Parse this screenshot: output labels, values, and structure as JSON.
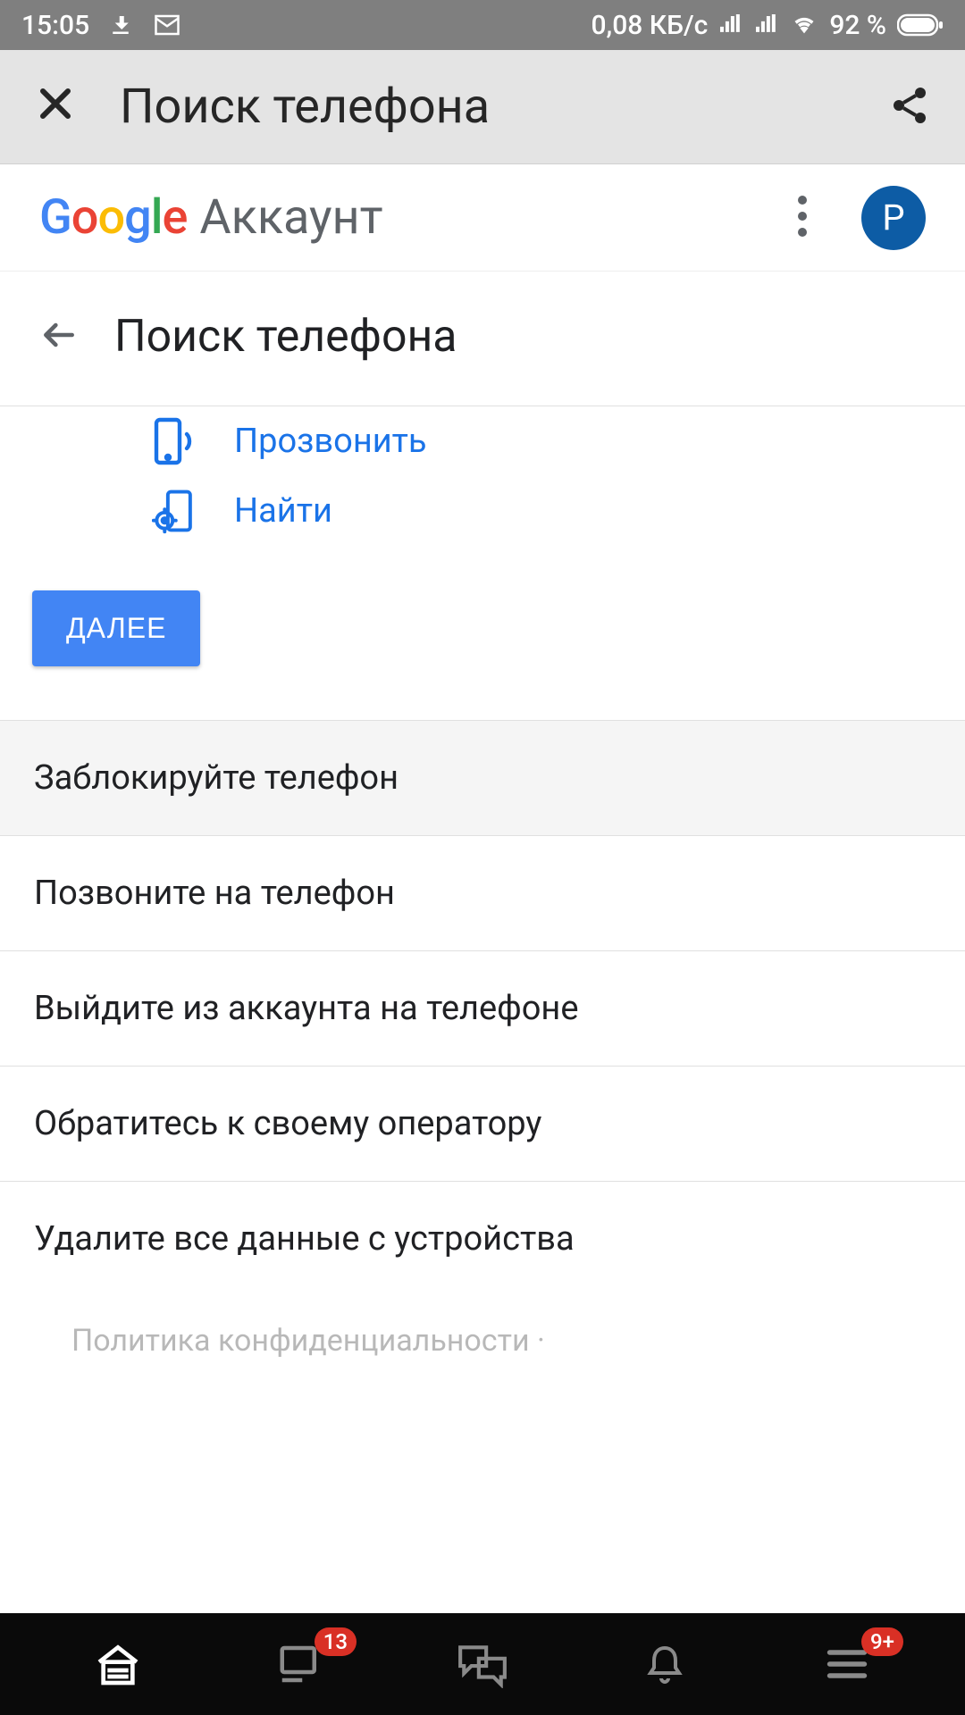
{
  "status": {
    "time": "15:05",
    "data_rate": "0,08 КБ/с",
    "battery": "92 %"
  },
  "app_header": {
    "title": "Поиск телефона"
  },
  "google_bar": {
    "account_label": "Аккаунт",
    "avatar_letter": "P"
  },
  "page": {
    "title": "Поиск телефона"
  },
  "actions": {
    "ring": "Прозвонить",
    "find": "Найти"
  },
  "next_button": "ДАЛЕЕ",
  "options": [
    "Заблокируйте телефон",
    "Позвоните на телефон",
    "Выйдите из аккаунта на телефоне",
    "Обратитесь к своему оператору",
    "Удалите все данные с устройства"
  ],
  "footer": {
    "privacy": "Политика конфиденциальности  ·"
  },
  "bottom_nav": {
    "badge1": "13",
    "badge2": "9+"
  }
}
